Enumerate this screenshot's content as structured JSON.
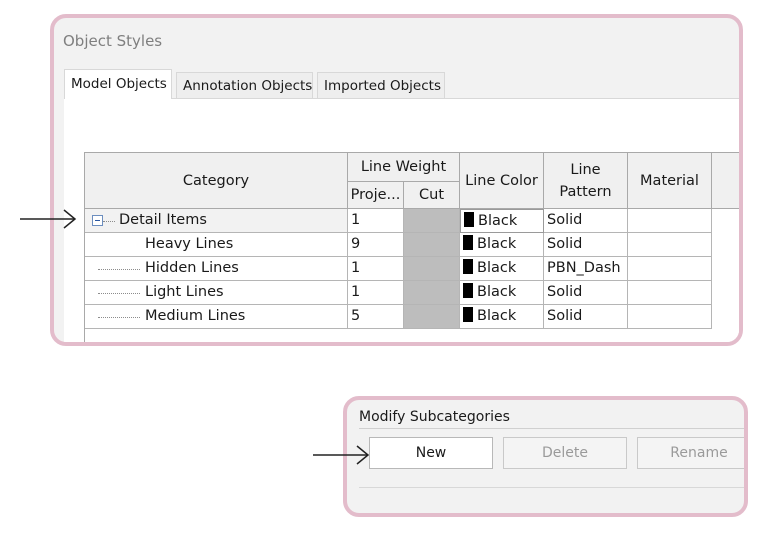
{
  "window": {
    "title": "Object Styles"
  },
  "tabs": [
    "Model Objects",
    "Annotation Objects",
    "Imported Objects"
  ],
  "table": {
    "headers": {
      "category": "Category",
      "line_weight": "Line Weight",
      "projection": "Proje...",
      "cut": "Cut",
      "line_color": "Line Color",
      "line_pattern": "Line\nPattern",
      "material": "Material"
    },
    "rows": [
      {
        "category": "Detail Items",
        "projection": "1",
        "color": "Black",
        "pattern": "Solid"
      },
      {
        "category": "Heavy Lines",
        "projection": "9",
        "color": "Black",
        "pattern": "Solid"
      },
      {
        "category": "Hidden Lines",
        "projection": "1",
        "color": "Black",
        "pattern": "PBN_Dash"
      },
      {
        "category": "Light Lines",
        "projection": "1",
        "color": "Black",
        "pattern": "Solid"
      },
      {
        "category": "Medium Lines",
        "projection": "5",
        "color": "Black",
        "pattern": "Solid"
      }
    ]
  },
  "subcategories": {
    "label": "Modify Subcategories",
    "new_label": "New",
    "delete_label": "Delete",
    "rename_label": "Rename"
  },
  "colors": {
    "highlight_border": "#e3bccb",
    "cut_fill": "#bdbdbd"
  },
  "icons": [
    "right-arrow-icon",
    "collapse-icon"
  ]
}
